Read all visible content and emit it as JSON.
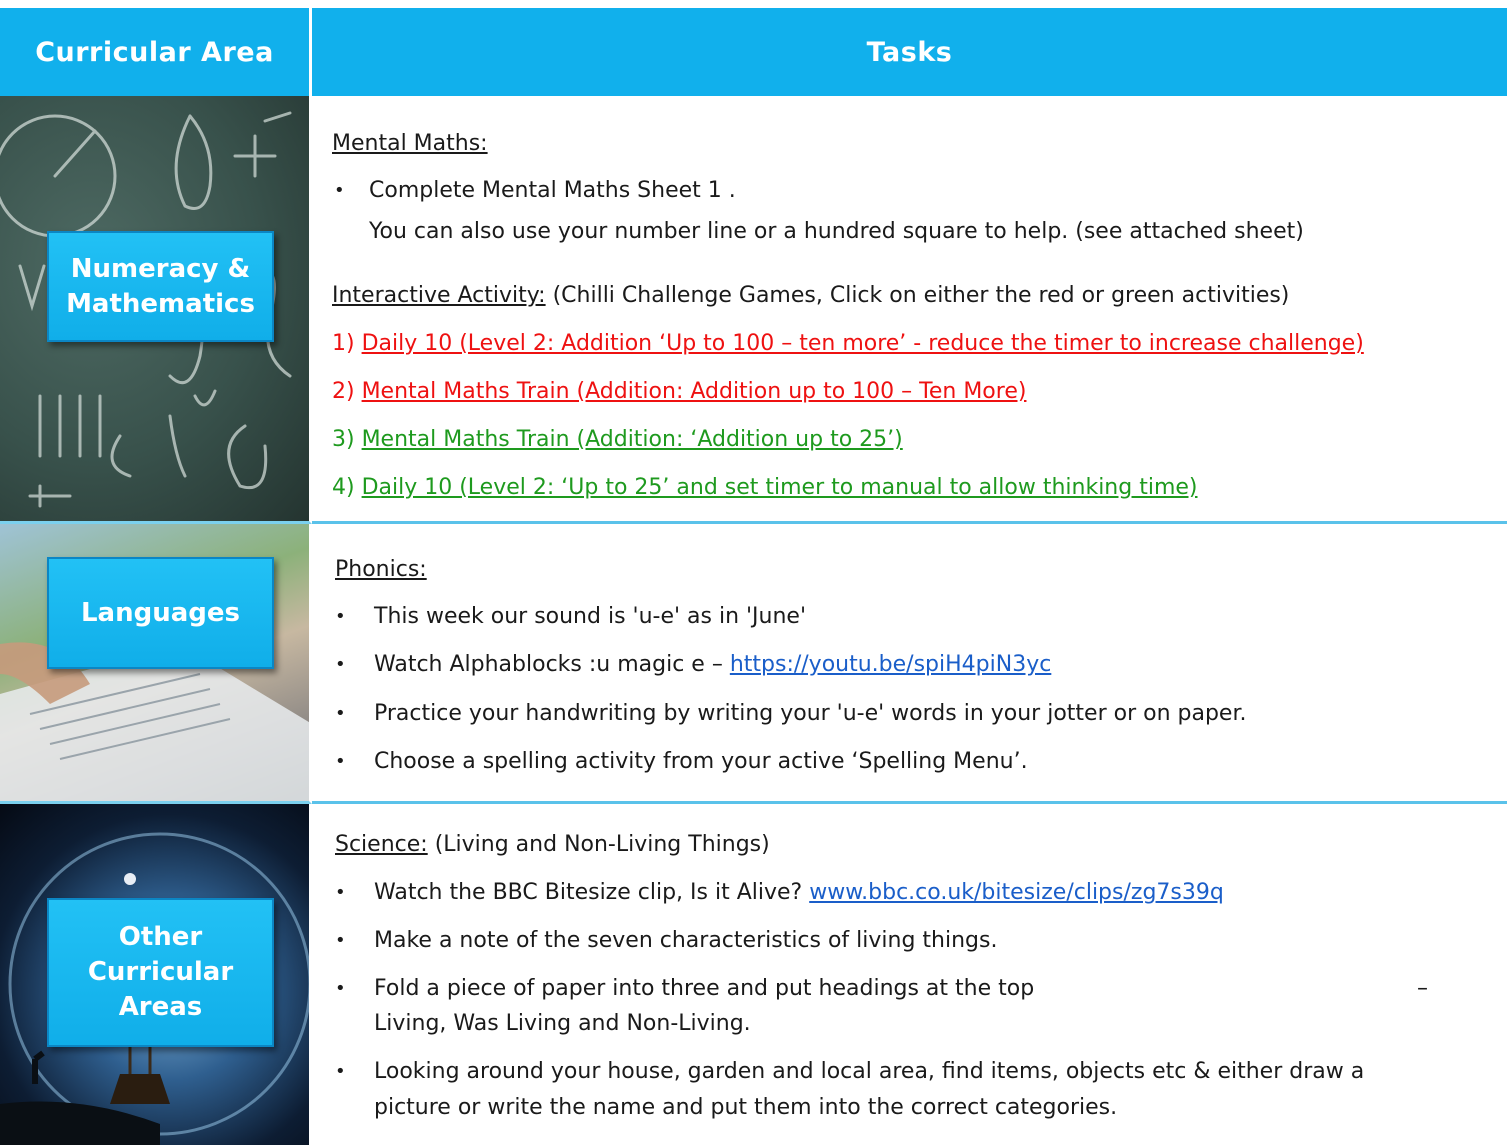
{
  "header": {
    "area_label": "Curricular Area",
    "tasks_label": "Tasks"
  },
  "rows": {
    "maths": {
      "area": [
        "Numeracy &",
        "Mathematics"
      ],
      "heading": "Mental Maths:",
      "bullet": "•",
      "line1": "Complete Mental Maths Sheet 1 .",
      "line2": "You can also use your number line or a hundred square to help. (see attached sheet)",
      "interactive_heading": "Interactive Activity:",
      "interactive_note": " (Chilli Challenge Games, Click on either the red or green activities)",
      "activities": [
        {
          "num": "1) ",
          "text": "Daily 10 (Level 2: Addition ‘Up to 100 – ten more’ - reduce the timer to increase challenge)",
          "color": "#ee1111"
        },
        {
          "num": "2) ",
          "text": "Mental Maths Train (Addition: Addition up to 100 – Ten More) ",
          "color": "#ee1111"
        },
        {
          "num": "3) ",
          "text": "Mental Maths Train (Addition: ‘Addition up to 25’)",
          "color": "#1e9a1e"
        },
        {
          "num": "4) ",
          "text": "Daily 10 (Level 2: ‘Up to 25’ and set timer to manual to allow thinking time)",
          "color": "#1e9a1e"
        }
      ]
    },
    "languages": {
      "area": "Languages",
      "heading": "Phonics:",
      "bullets": [
        "This week our sound is 'u-e' as in 'June'",
        "Watch Alphablocks :u magic e – ",
        "Practice your handwriting by writing your 'u-e' words in your jotter or on paper.",
        "Choose a spelling activity from your active ‘Spelling Menu’."
      ],
      "link": "https://youtu.be/spiH4piN3yc"
    },
    "other": {
      "area": [
        "Other",
        "Curricular",
        "Areas"
      ],
      "heading": "Science:",
      "heading_note": " (Living and Non-Living Things)",
      "b1": "Watch the BBC Bitesize clip, Is it Alive? ",
      "b1_link": "www.bbc.co.uk/bitesize/clips/zg7s39q",
      "b2": "Make a note of the seven characteristics of living things.",
      "b3a": "Fold a piece of paper into three and put headings at the top",
      "b3_dash": "–",
      "b3b": "Living, Was Living and Non-Living.",
      "b4a": "Looking around your house, garden and local area, find items, objects etc & either draw a",
      "b4b": "picture or write the name and put them into the correct categories."
    }
  },
  "colors": {
    "header_blue": "#11b0ec",
    "red": "#ee1111",
    "green": "#1e9a1e",
    "link": "#1a5ec9"
  }
}
